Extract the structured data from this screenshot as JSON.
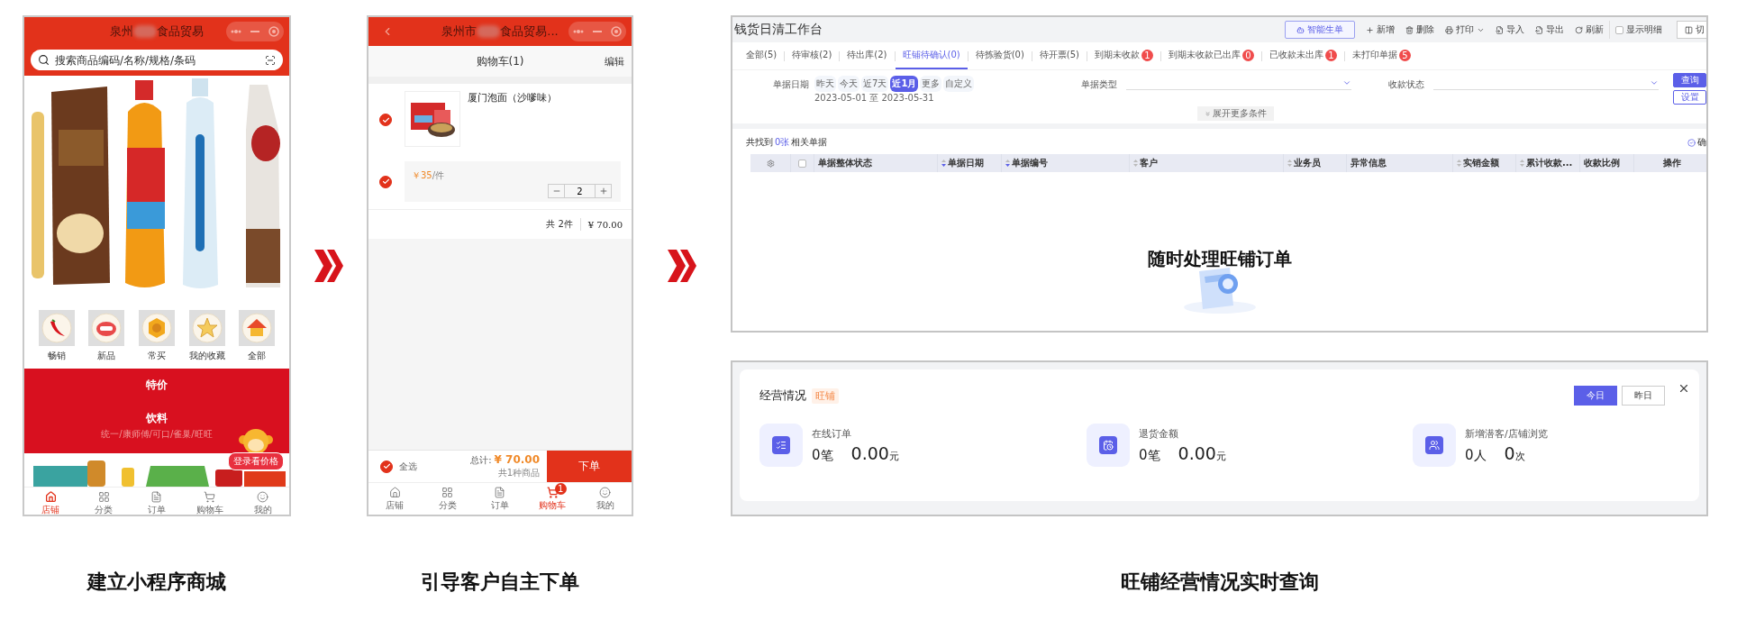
{
  "store_screen": {
    "title_start": "泉州",
    "title_end": "食品贸易",
    "search": {
      "placeholder": "搜索商品编码/名称/规格/条码"
    },
    "categories": [
      {
        "label": "畅销"
      },
      {
        "label": "新品"
      },
      {
        "label": "常买"
      },
      {
        "label": "我的收藏"
      },
      {
        "label": "全部"
      }
    ],
    "sections": [
      {
        "title": "特价"
      },
      {
        "title": "饮料",
        "subtitle": "统一/康师傅/可口/雀巢/旺旺"
      }
    ],
    "promo_badge": "登录看价格",
    "tabs": [
      {
        "label": "店铺",
        "selected": true
      },
      {
        "label": "分类",
        "selected": false
      },
      {
        "label": "订单",
        "selected": false
      },
      {
        "label": "购物车",
        "selected": false
      },
      {
        "label": "我的",
        "selected": false
      }
    ]
  },
  "cart_screen": {
    "title_start": "泉州市",
    "title_end": "食品贸易...",
    "header": "购物车(1)",
    "edit": "编辑",
    "items": [
      {
        "name": "厦门泡面（沙嗲味）",
        "checked": true,
        "price": "￥35",
        "unit": "/件",
        "spec_checked": true,
        "quantity": "2"
      }
    ],
    "summary": {
      "count": "共 2件",
      "amount": "¥ 70.00"
    },
    "footer": {
      "select_all": "全选",
      "select_all_checked": true,
      "total_label": "总计:",
      "total": "¥ 70.00",
      "kinds": "共1种商品",
      "submit": "下单"
    },
    "tabs": [
      {
        "label": "店铺",
        "selected": false
      },
      {
        "label": "分类",
        "selected": false
      },
      {
        "label": "订单",
        "selected": false
      },
      {
        "label": "购物车",
        "selected": true,
        "badge": "1"
      },
      {
        "label": "我的",
        "selected": false
      }
    ]
  },
  "workbench": {
    "title": "钱货日清工作台",
    "toolbar": [
      {
        "label": "智能生单",
        "kind": "primary"
      },
      {
        "label": "新增",
        "kind": "action"
      },
      {
        "label": "删除",
        "kind": "action"
      },
      {
        "label": "打印",
        "kind": "dropdown"
      },
      {
        "label": "导入",
        "kind": "action"
      },
      {
        "label": "导出",
        "kind": "action"
      },
      {
        "label": "刷新",
        "kind": "action"
      },
      {
        "label": "显示明细",
        "kind": "checkbox",
        "checked": false
      },
      {
        "label": "切",
        "kind": "switch"
      }
    ],
    "tabs": [
      {
        "label": "全部(5)",
        "selected": false
      },
      {
        "label": "待审核(2)",
        "selected": false
      },
      {
        "label": "待出库(2)",
        "selected": false
      },
      {
        "label": "旺铺待确认(0)",
        "selected": true
      },
      {
        "label": "待拣验货(0)",
        "selected": false
      },
      {
        "label": "待开票(5)",
        "selected": false
      },
      {
        "label": "到期未收款",
        "selected": false,
        "badge": "1"
      },
      {
        "label": "到期未收款已出库",
        "selected": false,
        "badge": "0"
      },
      {
        "label": "已收款未出库",
        "selected": false,
        "badge": "1"
      },
      {
        "label": "未打印单据",
        "selected": false,
        "badge": "5"
      }
    ],
    "filters": {
      "date_label": "单据日期",
      "date_chips": [
        {
          "label": "昨天",
          "selected": false
        },
        {
          "label": "今天",
          "selected": false
        },
        {
          "label": "近7天",
          "selected": false
        },
        {
          "label": "近1月",
          "selected": true
        },
        {
          "label": "更多",
          "selected": false
        },
        {
          "label": "自定义",
          "selected": false
        }
      ],
      "date_range": "2023-05-01 至 2023-05-31",
      "type_label": "单据类型",
      "status_label": "收款状态",
      "query": "查询",
      "settings": "设置",
      "expand": "展开更多条件"
    },
    "result": {
      "prefix": "共找到",
      "count": "0张",
      "suffix": "相关单据",
      "confirm": "确"
    },
    "select_all_checked": false,
    "columns": [
      {
        "label": "单据整体状态",
        "sortable": false
      },
      {
        "label": "单据日期",
        "sortable": true,
        "sorted": true
      },
      {
        "label": "单据编号",
        "sortable": true,
        "sorted": true
      },
      {
        "label": "客户",
        "sortable": true,
        "sorted": false
      },
      {
        "label": "业务员",
        "sortable": true,
        "sorted": false
      },
      {
        "label": "异常信息",
        "sortable": false
      },
      {
        "label": "实销金额",
        "sortable": true,
        "sorted": false
      },
      {
        "label": "累计收款...",
        "sortable": true,
        "sorted": false
      },
      {
        "label": "收款比例",
        "sortable": false
      },
      {
        "label": "操作",
        "sortable": false
      }
    ],
    "overlay": "随时处理旺铺订单"
  },
  "business_panel": {
    "title": "经营情况",
    "tag": "旺铺",
    "periods": [
      {
        "label": "今日",
        "selected": true
      },
      {
        "label": "昨日",
        "selected": false
      }
    ],
    "stats": [
      {
        "label": "在线订单",
        "values": [
          {
            "number": "0",
            "unit": "笔"
          },
          {
            "number": "0.00",
            "unit": "元"
          }
        ]
      },
      {
        "label": "退货金额",
        "values": [
          {
            "number": "0",
            "unit": "笔"
          },
          {
            "number": "0.00",
            "unit": "元"
          }
        ]
      },
      {
        "label": "新增潜客/店铺浏览",
        "values": [
          {
            "number": "0",
            "unit": "人"
          },
          {
            "number": "0",
            "unit": "次"
          }
        ]
      }
    ]
  },
  "captions": [
    "建立小程序商城",
    "引导客户自主下单",
    "旺铺经营情况实时查询"
  ]
}
